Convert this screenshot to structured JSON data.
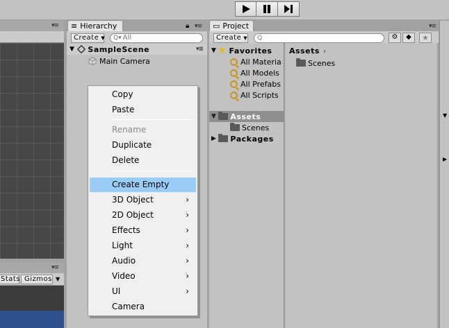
{
  "playbar": {
    "play": "▶",
    "pause": "❚❚",
    "step": "▶❚"
  },
  "scene_panel": {
    "stats": "Stats",
    "gizmos": "Gizmos"
  },
  "hierarchy": {
    "tab": "Hierarchy",
    "create": "Create",
    "search_placeholder": "All",
    "scene_name": "SampleScene",
    "objects": [
      "Main Camera"
    ]
  },
  "project": {
    "tab": "Project",
    "create": "Create",
    "favorites": {
      "label": "Favorites",
      "items": [
        "All Materia",
        "All Models",
        "All Prefabs",
        "All Scripts"
      ]
    },
    "assets": {
      "label": "Assets",
      "children": [
        "Scenes"
      ]
    },
    "packages": {
      "label": "Packages"
    },
    "breadcrumb": "Assets",
    "contents": [
      "Scenes"
    ]
  },
  "context_menu": {
    "items": [
      {
        "label": "Copy"
      },
      {
        "label": "Paste"
      },
      {
        "label": "Rename",
        "disabled": true
      },
      {
        "label": "Duplicate"
      },
      {
        "label": "Delete"
      },
      {
        "label": "Create Empty",
        "selected": true
      },
      {
        "label": "3D Object",
        "submenu": true
      },
      {
        "label": "2D Object",
        "submenu": true
      },
      {
        "label": "Effects",
        "submenu": true
      },
      {
        "label": "Light",
        "submenu": true
      },
      {
        "label": "Audio",
        "submenu": true
      },
      {
        "label": "Video",
        "submenu": true
      },
      {
        "label": "UI",
        "submenu": true
      },
      {
        "label": "Camera"
      }
    ]
  },
  "colors": {
    "selection": "#99ccf7",
    "panel": "#c2c2c2",
    "menu": "#f0f0f0"
  }
}
